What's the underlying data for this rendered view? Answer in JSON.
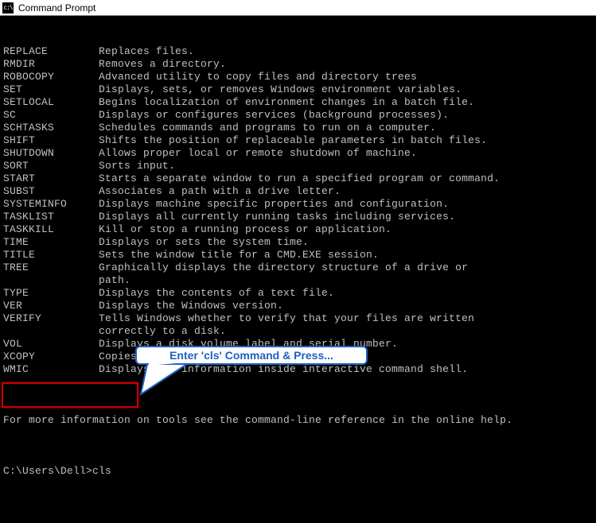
{
  "window": {
    "title": "Command Prompt",
    "icon_label": "cmd-icon"
  },
  "commands": [
    {
      "name": "REPLACE",
      "desc": "Replaces files."
    },
    {
      "name": "RMDIR",
      "desc": "Removes a directory."
    },
    {
      "name": "ROBOCOPY",
      "desc": "Advanced utility to copy files and directory trees"
    },
    {
      "name": "SET",
      "desc": "Displays, sets, or removes Windows environment variables."
    },
    {
      "name": "SETLOCAL",
      "desc": "Begins localization of environment changes in a batch file."
    },
    {
      "name": "SC",
      "desc": "Displays or configures services (background processes)."
    },
    {
      "name": "SCHTASKS",
      "desc": "Schedules commands and programs to run on a computer."
    },
    {
      "name": "SHIFT",
      "desc": "Shifts the position of replaceable parameters in batch files."
    },
    {
      "name": "SHUTDOWN",
      "desc": "Allows proper local or remote shutdown of machine."
    },
    {
      "name": "SORT",
      "desc": "Sorts input."
    },
    {
      "name": "START",
      "desc": "Starts a separate window to run a specified program or command."
    },
    {
      "name": "SUBST",
      "desc": "Associates a path with a drive letter."
    },
    {
      "name": "SYSTEMINFO",
      "desc": "Displays machine specific properties and configuration."
    },
    {
      "name": "TASKLIST",
      "desc": "Displays all currently running tasks including services."
    },
    {
      "name": "TASKKILL",
      "desc": "Kill or stop a running process or application."
    },
    {
      "name": "TIME",
      "desc": "Displays or sets the system time."
    },
    {
      "name": "TITLE",
      "desc": "Sets the window title for a CMD.EXE session."
    },
    {
      "name": "TREE",
      "desc": "Graphically displays the directory structure of a drive or\npath."
    },
    {
      "name": "TYPE",
      "desc": "Displays the contents of a text file."
    },
    {
      "name": "VER",
      "desc": "Displays the Windows version."
    },
    {
      "name": "VERIFY",
      "desc": "Tells Windows whether to verify that your files are written\ncorrectly to a disk."
    },
    {
      "name": "VOL",
      "desc": "Displays a disk volume label and serial number."
    },
    {
      "name": "XCOPY",
      "desc": "Copies files and directory trees."
    },
    {
      "name": "WMIC",
      "desc": "Displays WMI information inside interactive command shell."
    }
  ],
  "footer": "For more information on tools see the command-line reference in the online help.",
  "prompt": {
    "path": "C:\\Users\\Dell>",
    "input": "cls"
  },
  "callout": {
    "text": "Enter 'cls' Command & Press..."
  }
}
